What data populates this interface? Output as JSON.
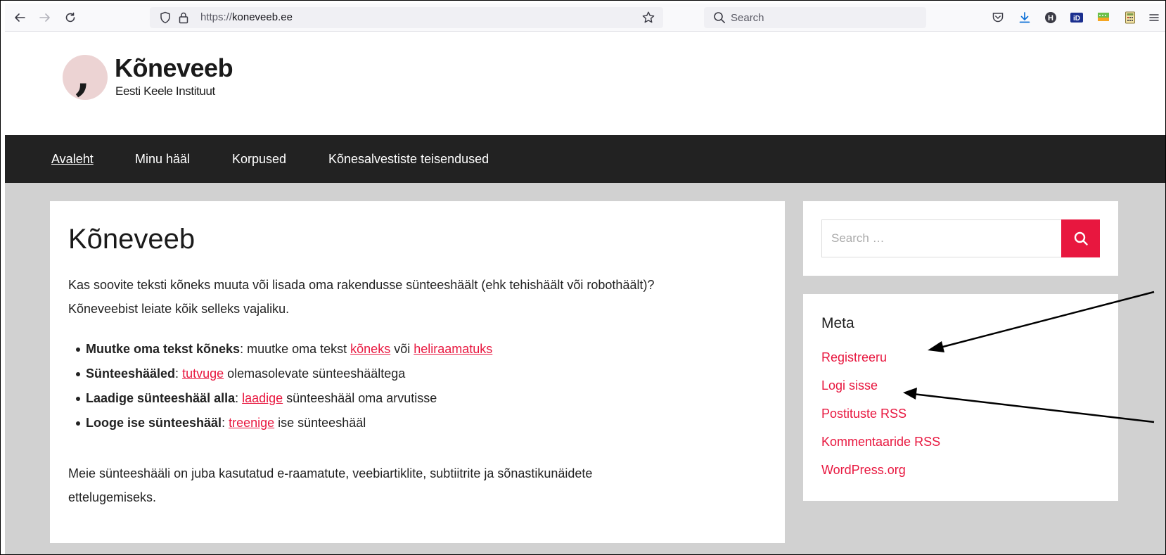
{
  "browser": {
    "back_icon": "arrow-left-icon",
    "forward_icon": "arrow-right-icon",
    "reload_icon": "reload-icon",
    "url_scheme": "https://",
    "url_host": "koneveeb.ee",
    "search_placeholder": "Search",
    "extensions": [
      "pocket-icon",
      "download-icon",
      "h-extension-icon",
      "id-extension-icon",
      "chat-extension-icon",
      "calculator-extension-icon",
      "menu-icon"
    ]
  },
  "site": {
    "title": "Kõneveeb",
    "subtitle": "Eesti Keele Instituut",
    "logo_mark": ","
  },
  "nav": {
    "items": [
      {
        "label": "Avaleht",
        "current": true
      },
      {
        "label": "Minu hääl",
        "current": false
      },
      {
        "label": "Korpused",
        "current": false
      },
      {
        "label": "Kõnesalvestiste teisendused",
        "current": false
      }
    ]
  },
  "article": {
    "title": "Kõneveeb",
    "intro_line1": "Kas soovite teksti kõneks muuta või lisada oma rakendusse sünteeshäält (ehk tehishäält või robothäält)?",
    "intro_line2": "Kõneveebist leiate kõik selleks vajaliku.",
    "features": [
      {
        "bold": "Muutke oma tekst kõneks",
        "sep": ": ",
        "text1": "muutke oma tekst ",
        "link1": "kõneks",
        "text2": " või ",
        "link2": "heliraamatuks",
        "text3": ""
      },
      {
        "bold": "Sünteeshääled",
        "sep": ": ",
        "text1": "",
        "link1": "tutvuge",
        "text2": " olemasolevate sünteeshäältega",
        "link2": "",
        "text3": ""
      },
      {
        "bold": "Laadige sünteeshääl alla",
        "sep": ": ",
        "text1": "",
        "link1": "laadige",
        "text2": " sünteeshääl oma arvutisse",
        "link2": "",
        "text3": ""
      },
      {
        "bold": "Looge ise sünteeshääl",
        "sep": ": ",
        "text1": "",
        "link1": "treenige",
        "text2": " ise sünteeshääl",
        "link2": "",
        "text3": ""
      }
    ],
    "outro_line1": "Meie sünteeshääli on juba kasutatud e-raamatute, veebiartiklite, subtiitrite ja sõnastikunäidete",
    "outro_line2": "ettelugemiseks."
  },
  "sidebar": {
    "search_placeholder": "Search …",
    "search_icon": "search-icon",
    "meta_title": "Meta",
    "meta_links": [
      "Registreeru",
      "Logi sisse",
      "Postituste RSS",
      "Kommentaaride RSS",
      "WordPress.org"
    ]
  },
  "colors": {
    "accent": "#e8173f",
    "nav_bg": "#222222",
    "content_bg": "#d1d1d1",
    "logo_circle": "#ecd3d3"
  }
}
